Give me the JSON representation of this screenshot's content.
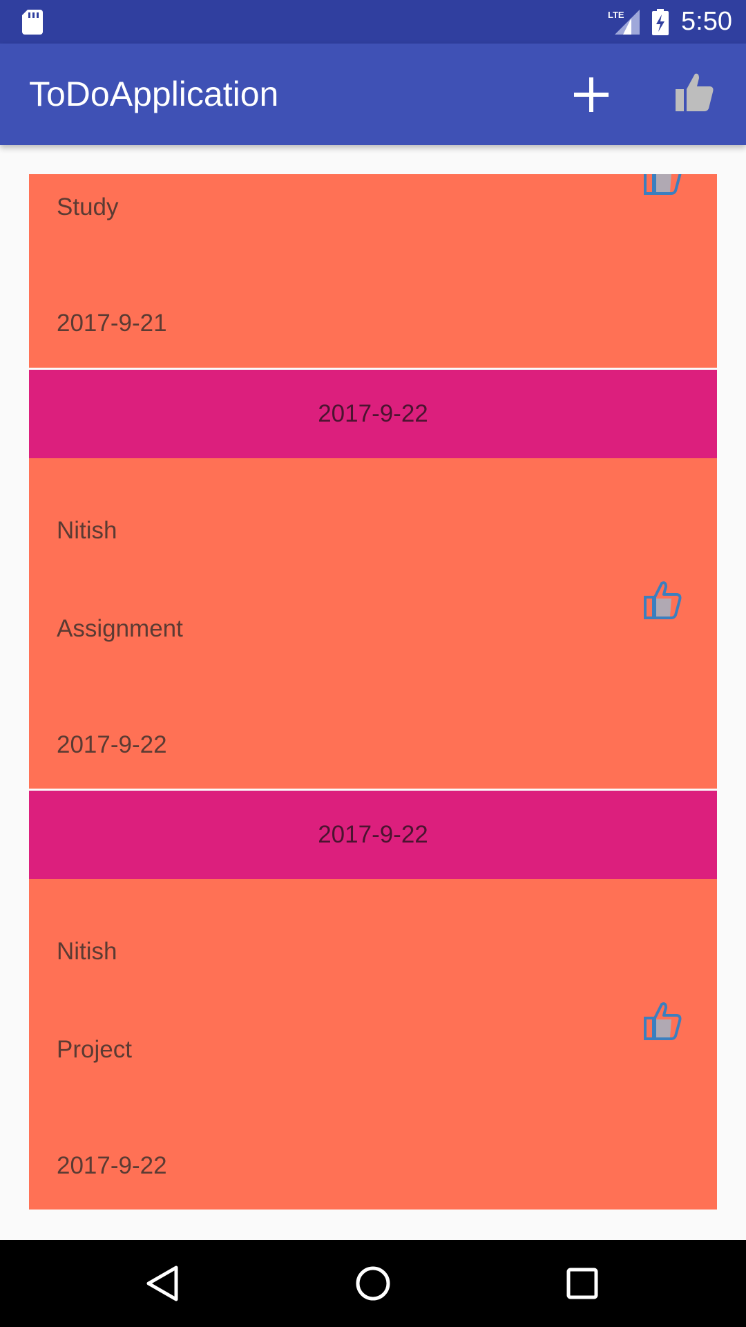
{
  "status_bar": {
    "network": "LTE",
    "time": "5:50"
  },
  "app_bar": {
    "title": "ToDoApplication"
  },
  "list": {
    "partial_item": {
      "lines": [
        "Study",
        "2017-9-21"
      ]
    },
    "groups": [
      {
        "header": "2017-9-22",
        "item": {
          "name": "Nitish",
          "task": "Assignment",
          "date": "2017-9-22"
        }
      },
      {
        "header": "2017-9-22",
        "item": {
          "name": "Nitish",
          "task": "Project",
          "date": "2017-9-22"
        }
      }
    ]
  },
  "colors": {
    "status_bar": "#303f9f",
    "app_bar": "#3f51b5",
    "card": "#ff7155",
    "header": "#dc1f7d",
    "background": "#fafafa"
  },
  "icons": {
    "add": "plus-icon",
    "app_like": "thumbs-up-icon",
    "item_like": "thumbs-up-icon",
    "nav_back": "triangle-back-icon",
    "nav_home": "circle-home-icon",
    "nav_recents": "square-recents-icon"
  }
}
